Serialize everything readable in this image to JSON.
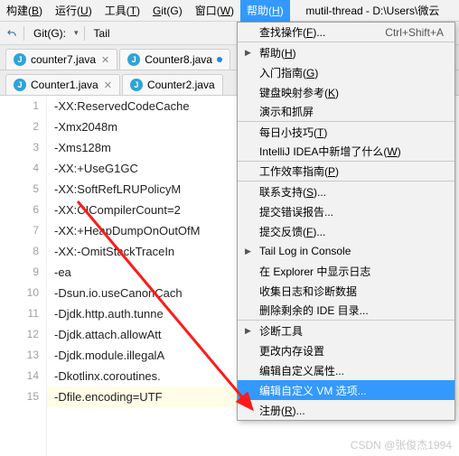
{
  "menubar": {
    "items": [
      {
        "label": "构建(B)",
        "u": "B"
      },
      {
        "label": "运行(U)",
        "u": "U"
      },
      {
        "label": "工具(T)",
        "u": "T"
      },
      {
        "label": "Git(G)",
        "u": "G"
      },
      {
        "label": "窗口(W)",
        "u": "W"
      },
      {
        "label": "帮助(H)",
        "u": "H",
        "active": true
      }
    ],
    "window_title": "mutil-thread - D:\\Users\\微云"
  },
  "toolbar": {
    "git_label": "Git(G):",
    "tail_label": "Tail"
  },
  "tabs_upper": [
    {
      "label": "counter7.java",
      "close": true
    },
    {
      "label": "Counter8.java",
      "dot": "#1e88e5"
    }
  ],
  "tabs_lower": [
    {
      "label": "Counter1.java",
      "close": true
    },
    {
      "label": "Counter2.java"
    }
  ],
  "code": {
    "start_line": 1,
    "lines": [
      "-XX:ReservedCodeCache",
      "-Xmx2048m",
      "-Xms128m",
      "-XX:+UseG1GC",
      "-XX:SoftRefLRUPolicyM",
      "-XX:CICompilerCount=2",
      "-XX:+HeapDumpOnOutOfM",
      "-XX:-OmitStackTraceIn",
      "-ea",
      "-Dsun.io.useCanonCach",
      "-Djdk.http.auth.tunne",
      "-Djdk.attach.allowAtt",
      "-Djdk.module.illegalA",
      "-Dkotlinx.coroutines.",
      "-Dfile.encoding=UTF"
    ],
    "highlight_line": 15
  },
  "help_menu": {
    "items": [
      {
        "label": "查找操作(F)...",
        "u": "F",
        "hotkey": "Ctrl+Shift+A",
        "sep": true
      },
      {
        "label": "帮助(H)",
        "u": "H",
        "submenu": true
      },
      {
        "label": "入门指南(G)",
        "u": "G"
      },
      {
        "label": "键盘映射参考(K)",
        "u": "K"
      },
      {
        "label": "演示和抓屏",
        "sep": true
      },
      {
        "label": "每日小技巧(T)",
        "u": "T"
      },
      {
        "label": "IntelliJ IDEA中新增了什么(W)",
        "u": "W",
        "sep": true
      },
      {
        "label": "工作效率指南(P)",
        "u": "P",
        "sep": true
      },
      {
        "label": "联系支持(S)...",
        "u": "S"
      },
      {
        "label": "提交错误报告..."
      },
      {
        "label": "提交反馈(F)...",
        "u": "F"
      },
      {
        "label": "Tail Log in Console",
        "submenu": true
      },
      {
        "label": "在 Explorer 中显示日志"
      },
      {
        "label": "收集日志和诊断数据"
      },
      {
        "label": "删除剩余的 IDE 目录...",
        "sep": true
      },
      {
        "label": "诊断工具",
        "submenu": true
      },
      {
        "label": "更改内存设置"
      },
      {
        "label": "编辑自定义属性..."
      },
      {
        "label": "编辑自定义 VM 选项...",
        "highlight": true
      },
      {
        "label": "注册(R)...",
        "u": "R"
      }
    ]
  },
  "watermark": "CSDN @张俊杰1994"
}
